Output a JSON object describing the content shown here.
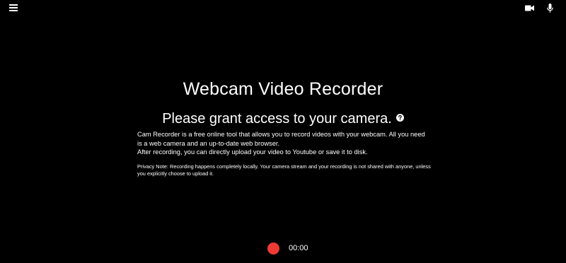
{
  "header": {
    "menu_icon": "hamburger-menu-icon",
    "camera_icon": "video-camera-icon",
    "mic_icon": "microphone-icon"
  },
  "main": {
    "title": "Webcam Video Recorder",
    "subtitle": "Please grant access to your camera.",
    "help_icon": "question-circle-icon",
    "description_line1": "Cam Recorder is a free online tool that allows you to record videos with your webcam. All you need is a web camera and an up-to-date web browser.",
    "description_line2": "After recording, you can directly upload your video to Youtube or save it to disk.",
    "privacy_note": "Privacy Note: Recording happens completely locally. Your camera stream and your recording is not shared with anyone, unless you explicitly choose to upload it."
  },
  "controls": {
    "record_icon": "record-icon",
    "timer": "00:00"
  },
  "colors": {
    "background": "#000000",
    "text": "#ffffff",
    "record": "#ef3b33"
  }
}
